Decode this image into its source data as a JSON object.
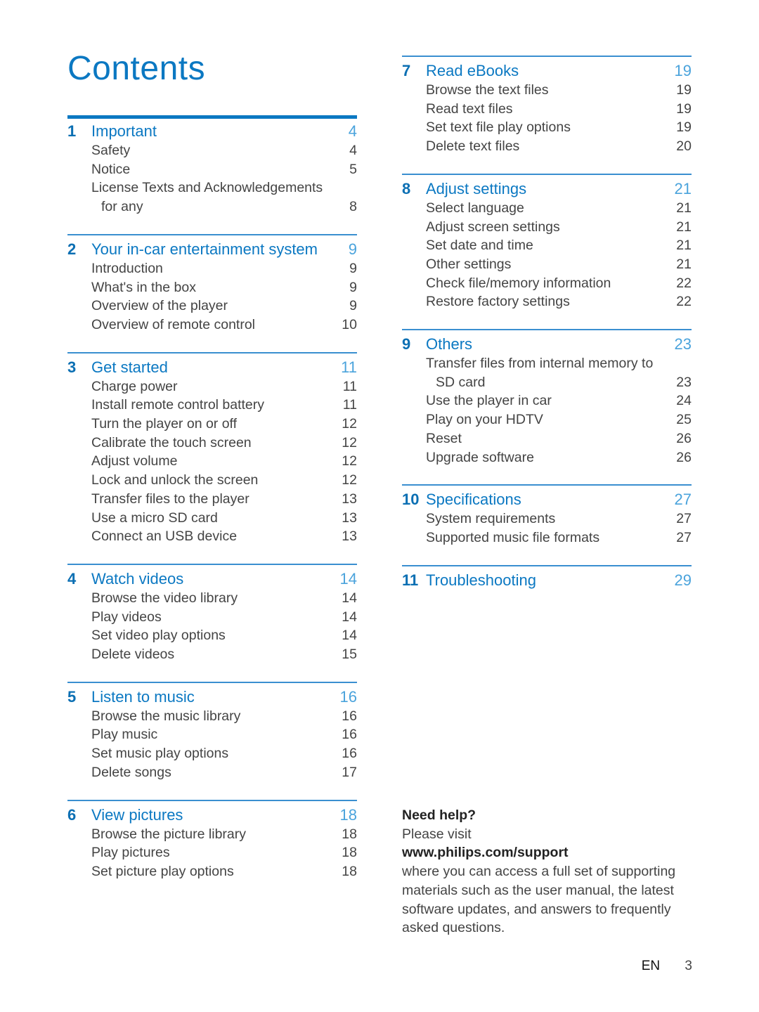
{
  "title": "Contents",
  "colors": {
    "accent": "#0b78c2",
    "page_number_accent": "#4aa3dc",
    "rule": "#3a8fd0",
    "text": "#444444"
  },
  "sections": [
    {
      "num": "1",
      "title": "Important",
      "page": "4",
      "items": [
        {
          "text": "Safety",
          "page": "4"
        },
        {
          "text": "Notice",
          "page": "5"
        },
        {
          "text": "License Texts and Acknowledgements",
          "page": ""
        },
        {
          "text": "for any",
          "page": "8",
          "continuation": true
        }
      ]
    },
    {
      "num": "2",
      "title": "Your in-car entertainment system",
      "page": "9",
      "items": [
        {
          "text": "Introduction",
          "page": "9"
        },
        {
          "text": "What's in the box",
          "page": "9"
        },
        {
          "text": "Overview of the player",
          "page": "9"
        },
        {
          "text": "Overview of remote control",
          "page": "10"
        }
      ]
    },
    {
      "num": "3",
      "title": "Get started",
      "page": "11",
      "items": [
        {
          "text": "Charge power",
          "page": "11"
        },
        {
          "text": "Install remote control battery",
          "page": "11"
        },
        {
          "text": "Turn the player on or off",
          "page": "12"
        },
        {
          "text": "Calibrate the touch screen",
          "page": "12"
        },
        {
          "text": "Adjust volume",
          "page": "12"
        },
        {
          "text": "Lock and unlock the screen",
          "page": "12"
        },
        {
          "text": "Transfer files to the player",
          "page": "13"
        },
        {
          "text": "Use a micro SD card",
          "page": "13"
        },
        {
          "text": "Connect an USB device",
          "page": "13"
        }
      ]
    },
    {
      "num": "4",
      "title": "Watch videos",
      "page": "14",
      "items": [
        {
          "text": "Browse the video library",
          "page": "14"
        },
        {
          "text": "Play videos",
          "page": "14"
        },
        {
          "text": "Set video play options",
          "page": "14"
        },
        {
          "text": "Delete videos",
          "page": "15"
        }
      ]
    },
    {
      "num": "5",
      "title": "Listen to music",
      "page": "16",
      "items": [
        {
          "text": "Browse the music library",
          "page": "16"
        },
        {
          "text": "Play music",
          "page": "16"
        },
        {
          "text": "Set music play options",
          "page": "16"
        },
        {
          "text": "Delete songs",
          "page": "17"
        }
      ]
    },
    {
      "num": "6",
      "title": "View pictures",
      "page": "18",
      "items": [
        {
          "text": "Browse the picture library",
          "page": "18"
        },
        {
          "text": "Play pictures",
          "page": "18"
        },
        {
          "text": "Set picture play options",
          "page": "18"
        }
      ]
    },
    {
      "num": "7",
      "title": "Read eBooks",
      "page": "19",
      "items": [
        {
          "text": "Browse the text files",
          "page": "19"
        },
        {
          "text": "Read text files",
          "page": "19"
        },
        {
          "text": "Set text file play options",
          "page": "19"
        },
        {
          "text": "Delete text files",
          "page": "20"
        }
      ]
    },
    {
      "num": "8",
      "title": "Adjust settings",
      "page": "21",
      "items": [
        {
          "text": "Select language",
          "page": "21"
        },
        {
          "text": "Adjust screen settings",
          "page": "21"
        },
        {
          "text": "Set date and time",
          "page": "21"
        },
        {
          "text": "Other settings",
          "page": "21"
        },
        {
          "text": "Check file/memory information",
          "page": "22"
        },
        {
          "text": "Restore factory settings",
          "page": "22"
        }
      ]
    },
    {
      "num": "9",
      "title": "Others",
      "page": "23",
      "items": [
        {
          "text": "Transfer files from internal memory to",
          "page": ""
        },
        {
          "text": "SD card",
          "page": "23",
          "continuation": true
        },
        {
          "text": "Use the player in car",
          "page": "24"
        },
        {
          "text": "Play on your HDTV",
          "page": "25"
        },
        {
          "text": "Reset",
          "page": "26"
        },
        {
          "text": "Upgrade software",
          "page": "26"
        }
      ]
    },
    {
      "num": "10",
      "title": "Specifications",
      "page": "27",
      "items": [
        {
          "text": "System requirements",
          "page": "27"
        },
        {
          "text": "Supported music file formats",
          "page": "27"
        }
      ]
    },
    {
      "num": "11",
      "title": "Troubleshooting",
      "page": "29",
      "items": []
    }
  ],
  "help": {
    "heading": "Need help?",
    "line1": "Please visit",
    "url": "www.philips.com/support",
    "body": "where you can access a full set of supporting materials such as the user manual, the latest software updates, and answers to frequently asked questions."
  },
  "footer": {
    "language": "EN",
    "page_number": "3"
  }
}
